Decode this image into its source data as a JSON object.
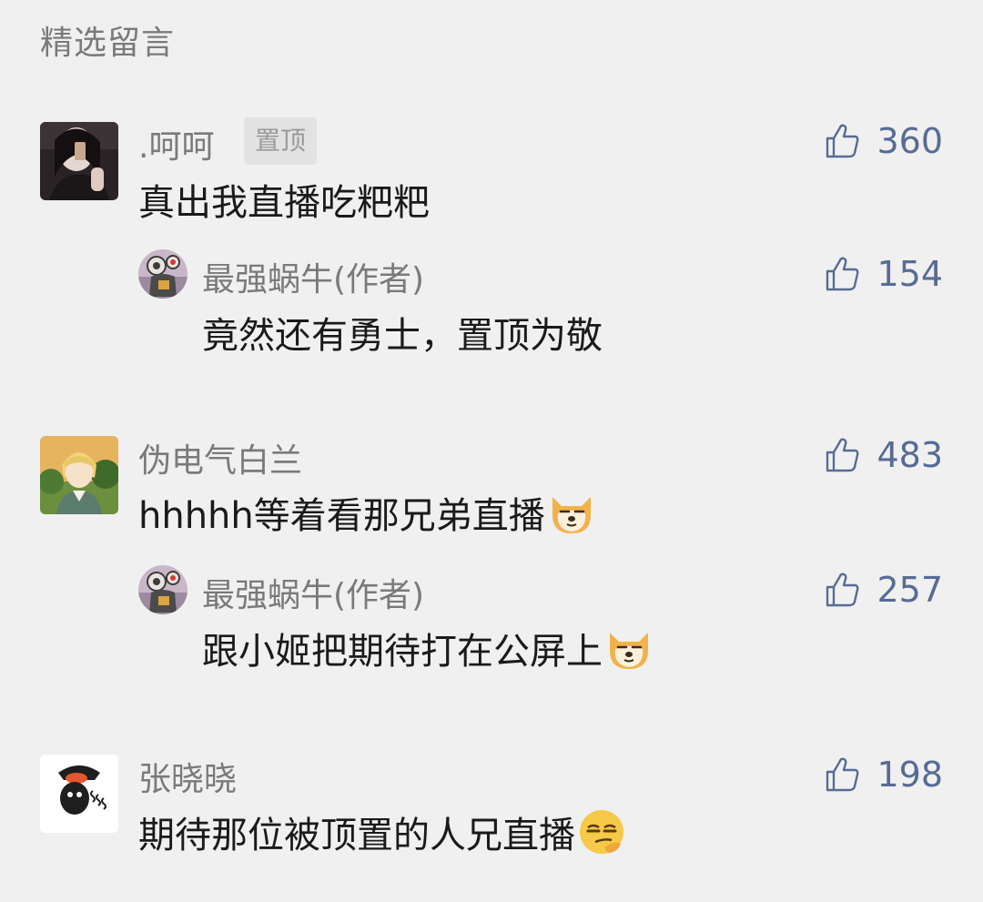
{
  "header": {
    "title": "精选留言"
  },
  "comments": [
    {
      "nickname": ".呵呵",
      "badge": "置顶",
      "text": "真出我直播吃粑粑",
      "likes": "360",
      "avatar": "dark-selfie-avatar",
      "reply": {
        "nickname": "最强蜗牛(作者)",
        "text": "竟然还有勇士，置顶为敬",
        "likes": "154",
        "avatar": "snail-robot-avatar"
      }
    },
    {
      "nickname": "伪电气白兰",
      "text": "hhhhh等着看那兄弟直播",
      "emoji": "doge-emoji",
      "likes": "483",
      "avatar": "anime-boy-avatar",
      "reply": {
        "nickname": "最强蜗牛(作者)",
        "text": "跟小姬把期待打在公屏上",
        "emoji": "doge-emoji",
        "likes": "257",
        "avatar": "snail-robot-avatar"
      }
    },
    {
      "nickname": "张晓晓",
      "text": "期待那位被顶置的人兄直播",
      "emoji": "smirk-emoji",
      "likes": "198",
      "avatar": "black-bird-avatar"
    }
  ],
  "colors": {
    "background": "#f0f0f0",
    "nickname": "#7a7a7a",
    "content": "#1a1a1a",
    "like": "#576b95"
  }
}
